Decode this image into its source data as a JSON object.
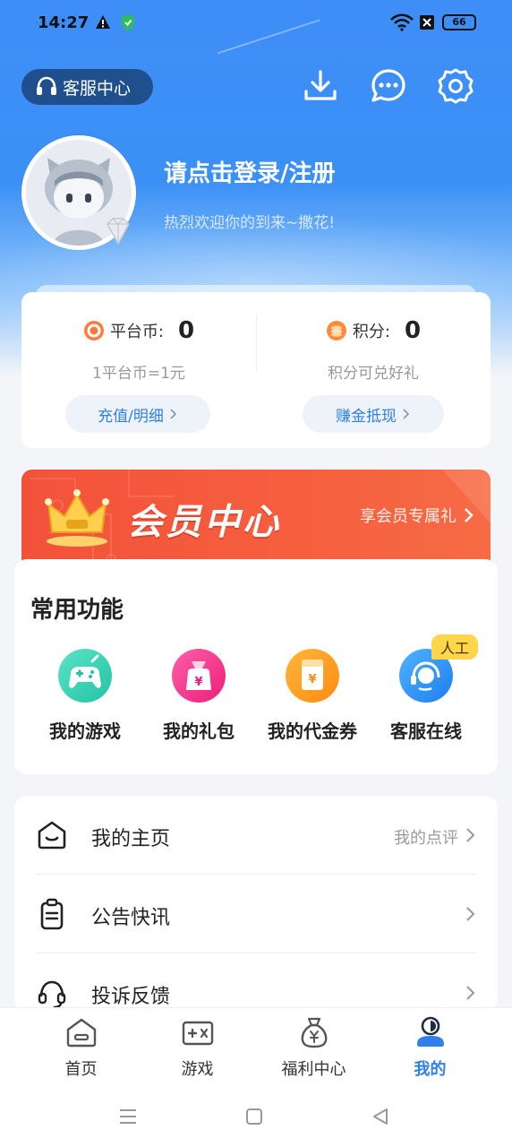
{
  "status_bar": {
    "time": "14:27",
    "battery": "66"
  },
  "header": {
    "service_center": "客服中心"
  },
  "profile": {
    "title": "请点击登录/注册",
    "subtitle": "热烈欢迎你的到来~撒花!"
  },
  "wallet": {
    "coins": {
      "label": "平台币:",
      "value": "0",
      "note": "1平台币=1元",
      "button": "充值/明细"
    },
    "points": {
      "label": "积分:",
      "value": "0",
      "note": "积分可兑好礼",
      "button": "赚金抵现"
    }
  },
  "vip": {
    "title": "会员中心",
    "link": "享会员专属礼"
  },
  "functions": {
    "title": "常用功能",
    "items": [
      {
        "label": "我的游戏",
        "icon": "gamepad-icon",
        "color": "#2fcfb0"
      },
      {
        "label": "我的礼包",
        "icon": "gift-bag-icon",
        "color": "#f4318a"
      },
      {
        "label": "我的代金券",
        "icon": "voucher-icon",
        "color": "#ff9a1a"
      },
      {
        "label": "客服在线",
        "icon": "headset-icon",
        "color": "#2f8cf0"
      }
    ],
    "badge": "人工"
  },
  "menu": {
    "rows": [
      {
        "label": "我的主页",
        "right": "我的点评",
        "icon": "home-page-icon"
      },
      {
        "label": "公告快讯",
        "right": "",
        "icon": "clipboard-icon"
      },
      {
        "label": "投诉反馈",
        "right": "",
        "icon": "headphones-icon"
      }
    ]
  },
  "bottom_nav": {
    "items": [
      {
        "label": "首页",
        "icon": "home-icon"
      },
      {
        "label": "游戏",
        "icon": "game-icon"
      },
      {
        "label": "福利中心",
        "icon": "money-bag-icon"
      },
      {
        "label": "我的",
        "icon": "user-icon",
        "active": true
      }
    ]
  },
  "colors": {
    "primary": "#2f80e8",
    "vip_red": "#f3523a",
    "badge_yellow": "#ffd64a"
  }
}
